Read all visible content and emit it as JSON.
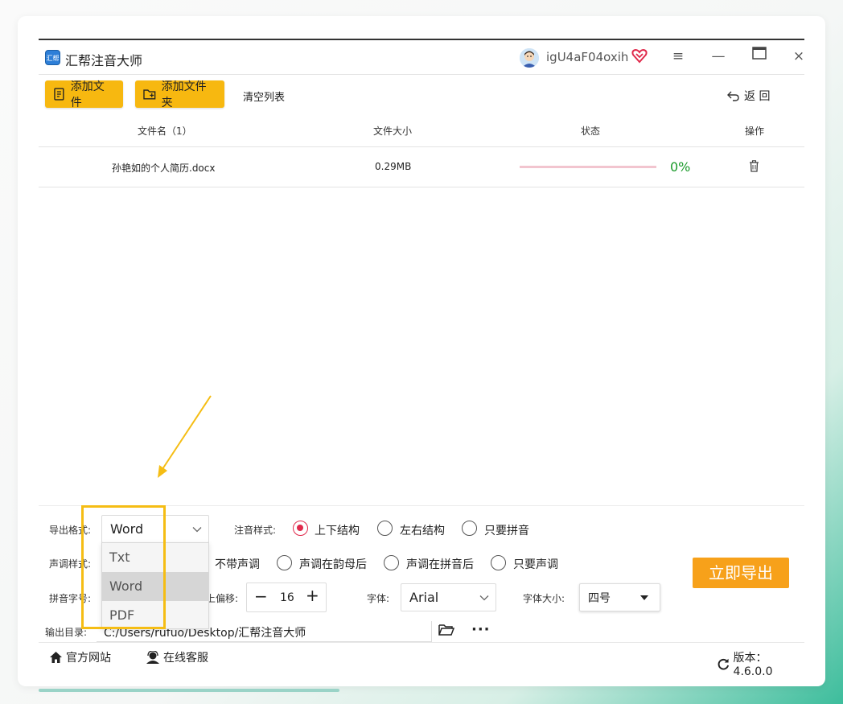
{
  "app": {
    "title": "汇帮注音大师",
    "icon_text": "汇帮"
  },
  "user": {
    "name": "igU4aF04oxih",
    "avatar_icon": "user-avatar-icon",
    "vip_icon": "vip-heart-icon"
  },
  "window_controls": {
    "menu": "≡",
    "minimize": "—",
    "maximize": "□",
    "close": "×"
  },
  "toolbar": {
    "add_file": "添加文件",
    "add_folder": "添加文件夹",
    "clear_list": "清空列表",
    "back": "返 回"
  },
  "table": {
    "headers": [
      "文件名（1）",
      "文件大小",
      "状态",
      "操作"
    ],
    "rows": [
      {
        "name": "孙艳如的个人简历.docx",
        "size": "0.29MB",
        "progress": 0,
        "status": "0%"
      }
    ]
  },
  "settings": {
    "export_format_label": "导出格式:",
    "export_format_value": "Word",
    "format_options": [
      "Txt",
      "Word",
      "PDF"
    ],
    "annotation_style_label": "注音样式:",
    "annotation_styles": [
      "上下结构",
      "左右结构",
      "只要拼音"
    ],
    "annotation_selected": 0,
    "tone_style_label": "声调样式:",
    "tone_styles": [
      "不带声调",
      "声调在韵母后",
      "声调在拼音后",
      "只要声调"
    ],
    "pinyin_size_label": "拼音字号:",
    "offset_label": "上偏移:",
    "offset_value": "16",
    "font_label": "字体:",
    "font_value": "Arial",
    "font_size_label": "字体大小:",
    "font_size_value": "四号",
    "export_button": "立即导出",
    "output_dir_label": "输出目录:",
    "output_dir_value": "C:/Users/rufuo/Desktop/汇帮注音大师"
  },
  "footer": {
    "website": "官方网站",
    "support": "在线客服",
    "version": "版本：4.6.0.0"
  },
  "colors": {
    "accent": "#f7b810",
    "export": "#f7a11a",
    "radio_on": "#e0294b",
    "progress_text": "#1a9a2a"
  }
}
